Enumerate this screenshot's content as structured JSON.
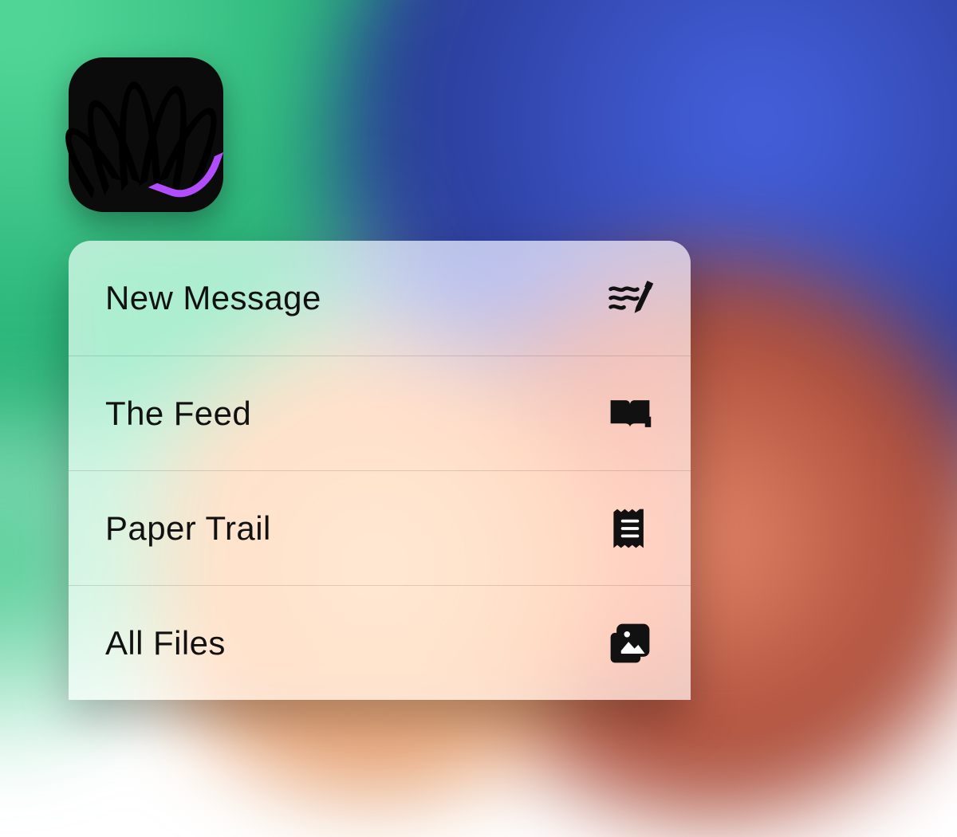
{
  "app_icon": {
    "name": "rainbow-hand-app"
  },
  "quick_actions": {
    "items": [
      {
        "label": "New Message",
        "icon": "compose-icon"
      },
      {
        "label": "The Feed",
        "icon": "book-open-icon"
      },
      {
        "label": "Paper Trail",
        "icon": "receipt-icon"
      },
      {
        "label": "All Files",
        "icon": "gallery-stack-icon"
      }
    ]
  }
}
